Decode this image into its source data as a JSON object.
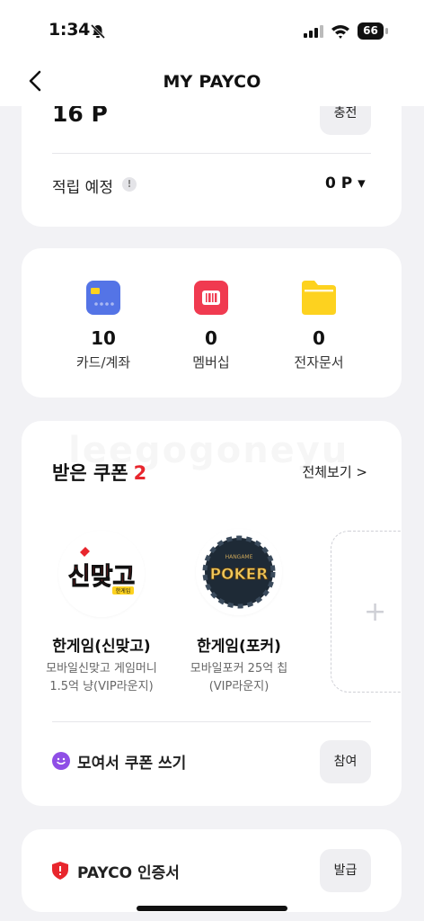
{
  "status_bar": {
    "time": "1:34",
    "battery": "66"
  },
  "header": {
    "title": "MY PAYCO"
  },
  "points_card": {
    "points": "16 P",
    "charge_label": "충전",
    "pending_label": "적립 예정",
    "pending_info": "!",
    "pending_value": "0 P ▾"
  },
  "stats": [
    {
      "value": "10",
      "label": "카드/계좌",
      "icon": "card-icon",
      "color": "#5474e6"
    },
    {
      "value": "0",
      "label": "멤버십",
      "icon": "barcode-icon",
      "color": "#f03a50"
    },
    {
      "value": "0",
      "label": "전자문서",
      "icon": "folder-icon",
      "color": "#fdd21f"
    }
  ],
  "coupons": {
    "title": "받은 쿠폰",
    "count": "2",
    "see_all": "전체보기 >",
    "watermark": "leegogoneyu",
    "items": [
      {
        "logo_text": "신맞고",
        "logo_sub": "한게임",
        "name": "한게임(신맞고)",
        "desc_line1": "모바일신맞고 게임머니",
        "desc_line2": "1.5억 냥(VIP라운지)"
      },
      {
        "logo_text": "POKER",
        "logo_sub": "HANGAME",
        "name": "한게임(포커)",
        "desc_line1": "모바일포커 25억 칩",
        "desc_line2": "(VIP라운지)"
      }
    ],
    "add_plus": "+",
    "gather_label": "모여서 쿠폰 쓰기",
    "join_label": "참여"
  },
  "certificate": {
    "label": "PAYCO 인증서",
    "issue_label": "발급"
  },
  "colors": {
    "accent_red": "#e8262d",
    "purple": "#8f4ee6"
  }
}
